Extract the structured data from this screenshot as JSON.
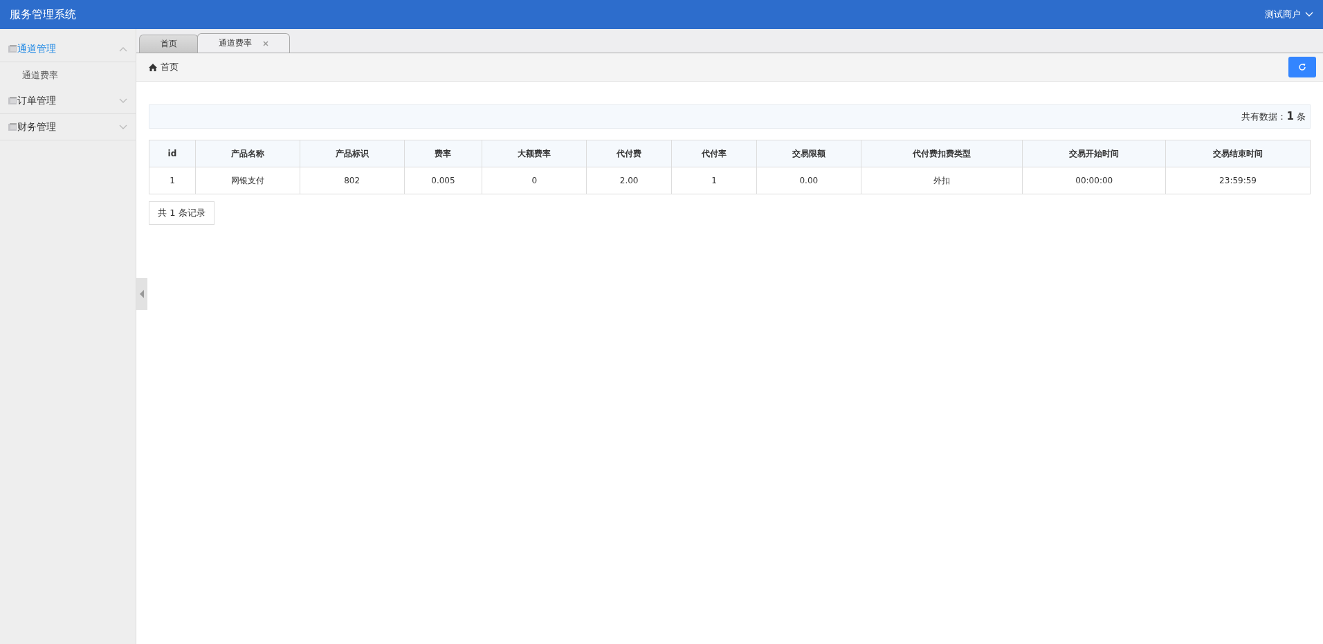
{
  "header": {
    "title": "服务管理系统",
    "user": "测试商户"
  },
  "sidebar": {
    "items": [
      {
        "label": "通道管理",
        "expanded": true,
        "children": [
          {
            "label": "通道费率"
          }
        ]
      },
      {
        "label": "订单管理",
        "expanded": false
      },
      {
        "label": "财务管理",
        "expanded": false
      }
    ]
  },
  "tabs": [
    {
      "label": "首页",
      "selected": false,
      "closable": false
    },
    {
      "label": "通道费率",
      "selected": true,
      "closable": true
    }
  ],
  "breadcrumb": "首页",
  "summary": "共有数据：**1** 条",
  "table": {
    "columns": [
      "id",
      "产品名称",
      "产品标识",
      "费率",
      "大额费率",
      "代付费",
      "代付率",
      "交易限额",
      "代付费扣费类型",
      "交易开始时间",
      "交易结束时间"
    ],
    "rows": [
      [
        "1",
        "网银支付",
        "802",
        "0.005",
        "0",
        "2.00",
        "1",
        "0.00",
        "外扣",
        "00:00:00",
        "23:59:59"
      ]
    ]
  },
  "pager": "共 1 条记录"
}
